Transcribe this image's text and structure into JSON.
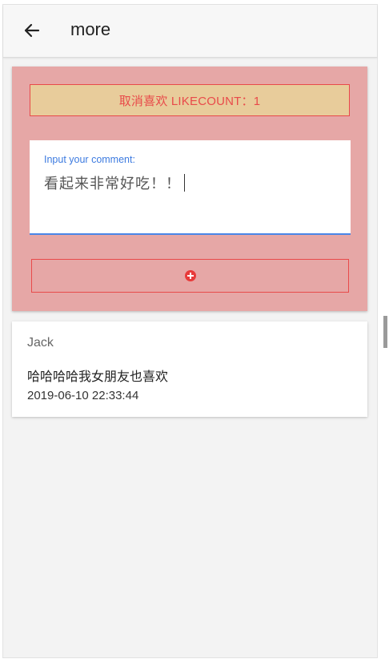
{
  "header": {
    "back_icon": "arrow-left-icon",
    "title": "more"
  },
  "like_card": {
    "like_button_label": "取消喜欢  LIKECOUNT：1",
    "comment_field": {
      "label": "Input your comment:",
      "value": "看起来非常好吃！！"
    },
    "add_button_icon": "plus-circle-icon"
  },
  "comments": [
    {
      "author": "Jack",
      "content": "哈哈哈哈我女朋友也喜欢",
      "time": "2019-06-10 22:33:44"
    }
  ],
  "colors": {
    "card_background": "#e6a7a6",
    "like_button_background": "#e8cc9b",
    "accent_red": "#e84a4a",
    "input_underline": "#4a86e8"
  }
}
